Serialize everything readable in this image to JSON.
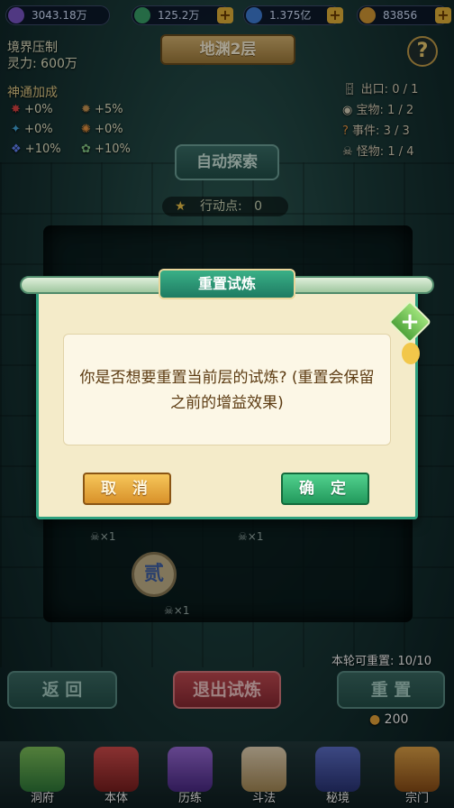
{
  "top_bar": {
    "level_value": "3043.18万",
    "coins": "125.2万",
    "gems": "1.375亿",
    "food": "83856"
  },
  "left_panel": {
    "realm_title": "境界压制",
    "spirit_label": "灵力: 600万",
    "bonus_title": "神通加成",
    "bonuses": [
      "+0%",
      "+5%",
      "+0%",
      "+0%",
      "+10%",
      "+10%"
    ]
  },
  "floor_title": "地渊2层",
  "right_stats": [
    {
      "label": "出口:",
      "value": "0 / 1"
    },
    {
      "label": "宝物:",
      "value": "1 / 2"
    },
    {
      "label": "事件:",
      "value": "3 / 3"
    },
    {
      "label": "怪物:",
      "value": "1 / 4"
    }
  ],
  "auto_explore": "自动探索",
  "action_points": {
    "label": "行动点:",
    "value": "0"
  },
  "dialog": {
    "title": "重置试炼",
    "message": "你是否想要重置当前层的试炼? (重置会保留之前的增益效果)",
    "cancel": "取 消",
    "confirm": "确 定"
  },
  "board": {
    "skull_counts": [
      "×1",
      "×1",
      "×1"
    ],
    "token_glyph": "贰"
  },
  "reset_remaining": "本轮可重置: 10/10",
  "reset_cost": "200",
  "buttons": {
    "back": "返 回",
    "exit": "退出试炼",
    "reset": "重 置"
  },
  "nav": [
    "洞府",
    "本体",
    "历练",
    "斗法",
    "秘境",
    "宗门"
  ]
}
